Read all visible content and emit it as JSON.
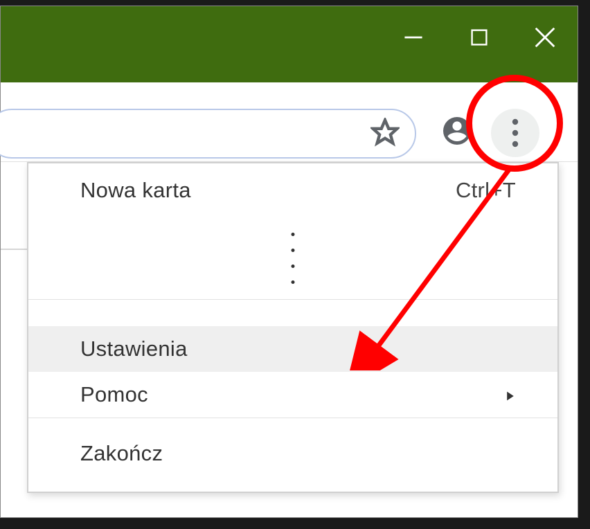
{
  "window_controls": {
    "minimize": "minimize",
    "maximize": "maximize",
    "close": "close"
  },
  "toolbar": {
    "bookmark": "star",
    "profile": "profile",
    "menu_dots": "more"
  },
  "menu": {
    "new_tab": {
      "label": "Nowa karta",
      "shortcut": "Ctrl+T"
    },
    "settings": {
      "label": "Ustawienia"
    },
    "help": {
      "label": "Pomoc"
    },
    "exit": {
      "label": "Zakończ"
    }
  },
  "annotations": {
    "circle_color": "#ff0000",
    "arrow_color": "#ff0000"
  }
}
